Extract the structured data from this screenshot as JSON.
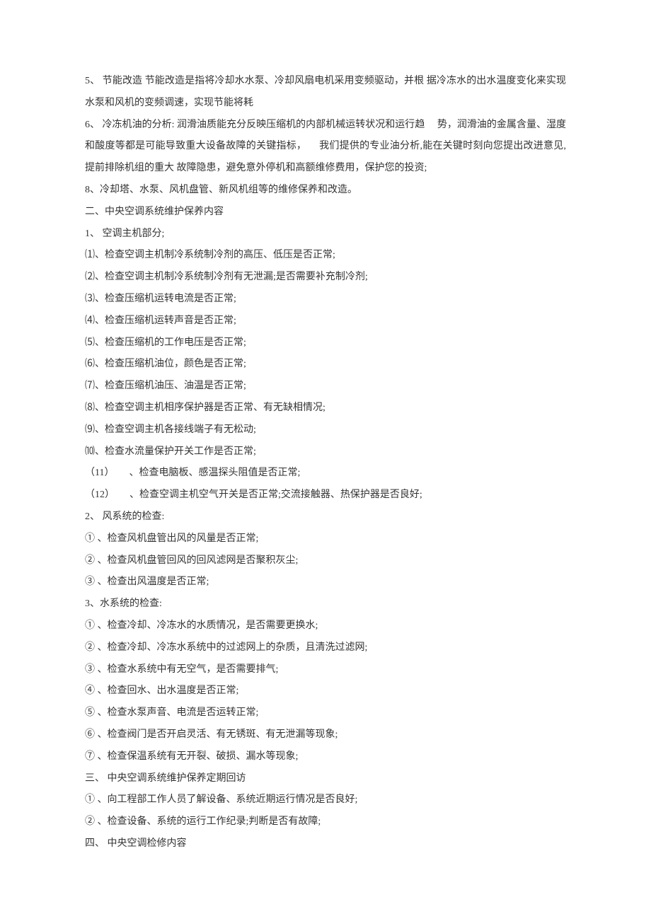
{
  "lines": [
    "5、 节能改造 节能改造是指将冷却水水泵、冷却风扇电机采用变频驱动，并根 据冷冻水的出水温度变化来实现水泵和风机的变频调速，实现节能将耗",
    "6、 冷冻机油的分析: 润滑油质能充分反映压缩机的内部机械运转状况和运行趋 　势，润滑油的金属含量、湿度和酸度等都是可能导致重大设备故障的关键指标， 　我们提供的专业油分析,能在关键时刻向您提出改进意见,提前排除机组的重大 故障隐患，避免意外停机和高额维修费用，保护您的投资;",
    "8、冷却塔、水泵、风机盘管、新风机组等的维修保养和改造。",
    "二、中央空调系统维护保养内容",
    "1、 空调主机部分;",
    "⑴、检查空调主机制冷系统制冷剂的高压、低压是否正常;",
    "⑵、检查空调主机制冷系统制冷剂有无泄漏;是否需要补充制冷剂;",
    "⑶、检查压缩机运转电流是否正常;",
    "⑷、检查压缩机运转声音是否正常;",
    "⑸、检查压缩机的工作电压是否正常;",
    "⑹、检查压缩机油位，颜色是否正常;",
    "⑺、检查压缩机油压、油温是否正常;",
    "⑻、检查空调主机相序保护器是否正常、有无缺相情况;",
    "⑼、检查空调主机各接线端子有无松动;",
    "⑽、检查水流量保护开关工作是否正常;",
    "（11）　　、检查电脑板、感温探头阻值是否正常;",
    "（12）　　、检查空调主机空气开关是否正常;交流接触器、热保护器是否良好;",
    "2、 风系统的检查:",
    "① 、检查风机盘管出风的风量是否正常;",
    "② 、检查风机盘管回风的回风滤网是否聚积灰尘;",
    "③ 、检查出风温度是否正常;",
    "3、水系统的检查:",
    "① 、检查冷却、冷冻水的水质情况，是否需要更换水;",
    "② 、检查冷却、冷冻水系统中的过滤网上的杂质，且清洗过滤网;",
    "③ 、检查水系统中有无空气，是否需要排气;",
    "④ 、检查回水、出水温度是否正常;",
    "⑤ 、检查水泵声音、电流是否运转正常;",
    "⑥ 、检查阀门是否开启灵活、有无锈斑、有无泄漏等现象;",
    "⑦ 、检查保温系统有无开裂、破损、漏水等现象;",
    "三、 中央空调系统维护保养定期回访",
    "① 、向工程部工作人员了解设备、系统近期运行情况是否良好;",
    "② 、检查设备、系统的运行工作纪录;判断是否有故障;",
    "四、 中央空调检修内容"
  ]
}
